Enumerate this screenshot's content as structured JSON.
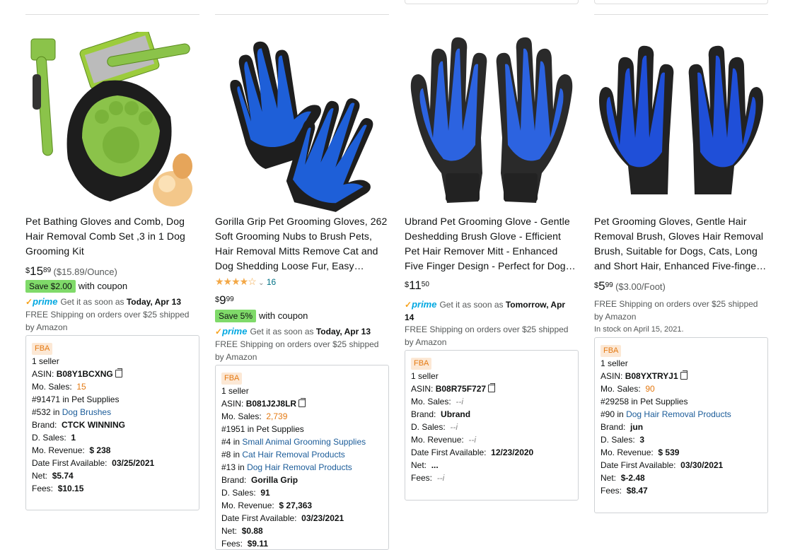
{
  "products": [
    {
      "title": "Pet Bathing Gloves and Comb, Dog Hair Removal Comb Set ,3 in 1 Dog Grooming Kit",
      "price_symbol": "$",
      "price_whole": "15",
      "price_frac": "89",
      "price_unit": "($15.89/Ounce)",
      "save_badge": "Save $2.00",
      "coupon_text": "with coupon",
      "prime_label": "prime",
      "delivery_prefix": "Get it as soon as",
      "delivery_date": "Today, Apr 13",
      "shipping": "FREE Shipping on orders over $25 shipped by Amazon",
      "info": {
        "fba": "FBA",
        "sellers": "1 seller",
        "asin_label": "ASIN:",
        "asin": "B08Y1BCXNG",
        "mo_sales_label": "Mo. Sales:",
        "mo_sales": "15",
        "rank1": "#91471",
        "rank1_in": "in",
        "rank1_cat": "Pet Supplies",
        "rank2": "#532",
        "rank2_in": "in",
        "rank2_cat": "Dog Brushes",
        "brand_label": "Brand:",
        "brand": "CTCK WINNING",
        "d_sales_label": "D. Sales:",
        "d_sales": "1",
        "mo_revenue_label": "Mo. Revenue:",
        "mo_revenue": "$ 238",
        "date_label": "Date First Available:",
        "date": "03/25/2021",
        "net_label": "Net:",
        "net": "$5.74",
        "fees_label": "Fees:",
        "fees": "$10.15"
      }
    },
    {
      "title": "Gorilla Grip Pet Grooming Gloves, 262 Soft Grooming Nubs to Brush Pets, Hair Removal Mitts Remove Cat and Dog Shedding Loose Fur, Easy…",
      "rating_count": "16",
      "price_symbol": "$",
      "price_whole": "9",
      "price_frac": "99",
      "save_badge": "Save 5%",
      "coupon_text": "with coupon",
      "prime_label": "prime",
      "delivery_prefix": "Get it as soon as",
      "delivery_date": "Today, Apr 13",
      "shipping": "FREE Shipping on orders over $25 shipped by Amazon",
      "info": {
        "fba": "FBA",
        "sellers": "1 seller",
        "asin_label": "ASIN:",
        "asin": "B081J2J8LR",
        "mo_sales_label": "Mo. Sales:",
        "mo_sales": "2,739",
        "rank1": "#1951",
        "rank1_in": "in",
        "rank1_cat": "Pet Supplies",
        "rank2": "#4",
        "rank2_in": "in",
        "rank2_cat": "Small Animal Grooming Supplies",
        "rank3": "#8",
        "rank3_in": "in",
        "rank3_cat": "Cat Hair Removal Products",
        "rank4": "#13",
        "rank4_in": "in",
        "rank4_cat": "Dog Hair Removal Products",
        "brand_label": "Brand:",
        "brand": "Gorilla Grip",
        "d_sales_label": "D. Sales:",
        "d_sales": "91",
        "mo_revenue_label": "Mo. Revenue:",
        "mo_revenue": "$ 27,363",
        "date_label": "Date First Available:",
        "date": "03/23/2021",
        "net_label": "Net:",
        "net": "$0.88",
        "fees_label": "Fees:",
        "fees": "$9.11"
      }
    },
    {
      "title": "Ubrand Pet Grooming Glove - Gentle Deshedding Brush Glove - Efficient Pet Hair Remover Mitt - Enhanced Five Finger Design - Perfect for Dog…",
      "price_symbol": "$",
      "price_whole": "11",
      "price_frac": "50",
      "prime_label": "prime",
      "delivery_prefix": "Get it as soon as",
      "delivery_date": "Tomorrow, Apr",
      "delivery_date2": "14",
      "shipping": "FREE Shipping on orders over $25 shipped by Amazon",
      "info": {
        "fba": "FBA",
        "sellers": "1 seller",
        "asin_label": "ASIN:",
        "asin": "B08R75F727",
        "mo_sales_label": "Mo. Sales:",
        "mo_sales": "--i",
        "brand_label": "Brand:",
        "brand": "Ubrand",
        "d_sales_label": "D. Sales:",
        "d_sales": "--i",
        "mo_revenue_label": "Mo. Revenue:",
        "mo_revenue": "--i",
        "date_label": "Date First Available:",
        "date": "12/23/2020",
        "net_label": "Net:",
        "net": "...",
        "fees_label": "Fees:",
        "fees": "--i"
      }
    },
    {
      "title": "Pet Grooming Gloves, Gentle Hair Removal Brush, Gloves Hair Removal Brush, Suitable for Dogs, Cats, Long and Short Hair, Enhanced Five-finge…",
      "price_symbol": "$",
      "price_whole": "5",
      "price_frac": "99",
      "price_unit": "($3.00/Foot)",
      "shipping": "FREE Shipping on orders over $25 shipped by Amazon",
      "stock": "In stock on April 15, 2021.",
      "info": {
        "fba": "FBA",
        "sellers": "1 seller",
        "asin_label": "ASIN:",
        "asin": "B08YXTRYJ1",
        "mo_sales_label": "Mo. Sales:",
        "mo_sales": "90",
        "rank1": "#29258",
        "rank1_in": "in",
        "rank1_cat": "Pet Supplies",
        "rank2": "#90",
        "rank2_in": "in",
        "rank2_cat": "Dog Hair Removal Products",
        "brand_label": "Brand:",
        "brand": "jun",
        "d_sales_label": "D. Sales:",
        "d_sales": "3",
        "mo_revenue_label": "Mo. Revenue:",
        "mo_revenue": "$ 539",
        "date_label": "Date First Available:",
        "date": "03/30/2021",
        "net_label": "Net:",
        "net": "$-2.48",
        "fees_label": "Fees:",
        "fees": "$8.47"
      }
    }
  ],
  "icons": [
    "copy-icon",
    "star-icon",
    "prime-check-icon",
    "chevron-down-icon"
  ],
  "colors": {
    "link": "#1b5c99",
    "orange": "#e47911",
    "save_badge": "#7fda69",
    "prime": "#00a8e1"
  }
}
